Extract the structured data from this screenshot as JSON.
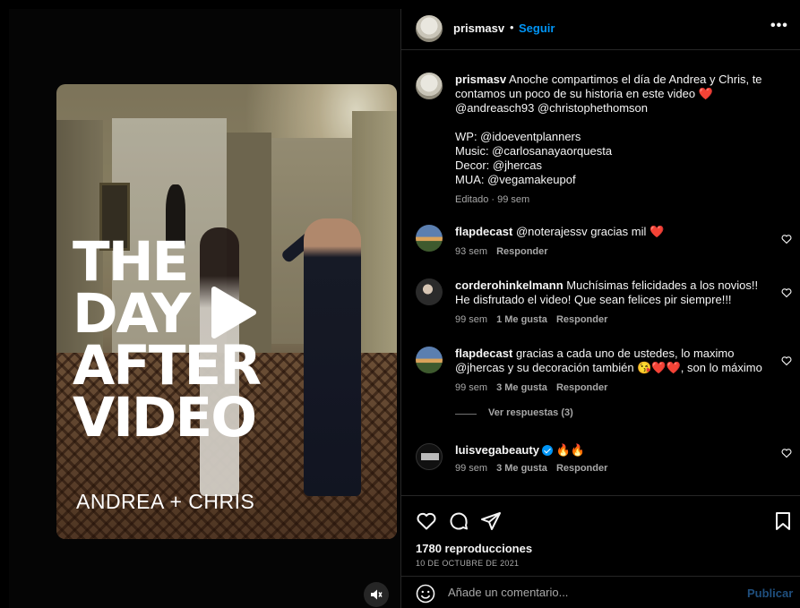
{
  "video": {
    "title_lines": [
      "THE",
      "DAY",
      "AFTER",
      "VIDEO"
    ],
    "subtitle": "ANDREA + CHRIS"
  },
  "header": {
    "username": "prismasv",
    "dot": "•",
    "follow_label": "Seguir",
    "more": "•••"
  },
  "caption": {
    "username": "prismasv",
    "lines": [
      "Anoche compartimos el día de Andrea y Chris, te",
      "contamos un poco de su historia en este video ❤️",
      "@andreasch93 @christophethomson",
      "",
      "WP: @idoeventplanners",
      "Music: @carlosanayaorquesta",
      "Decor: @jhercas",
      "MUA: @vegamakeupof"
    ],
    "meta": "Editado · 99 sem"
  },
  "comments": [
    {
      "username": "flapdecast",
      "text": "@noterajessv gracias mil ❤️",
      "time": "93 sem",
      "likes": "",
      "reply": "Responder"
    },
    {
      "username": "corderohinkelmann",
      "text": "Muchísimas felicidades a los novios!! He disfrutado el video! Que sean felices pir siempre!!!",
      "time": "99 sem",
      "likes": "1 Me gusta",
      "reply": "Responder"
    },
    {
      "username": "flapdecast",
      "text": "gracias a cada uno de ustedes, lo maximo @jhercas y su decoración también 😘❤️❤️, son lo máximo",
      "time": "99 sem",
      "likes": "3 Me gusta",
      "reply": "Responder"
    },
    {
      "username": "luisvegabeauty",
      "text": "🔥🔥",
      "time": "99 sem",
      "likes": "3 Me gusta",
      "reply": "Responder"
    }
  ],
  "view_replies": "Ver respuestas (3)",
  "stats": {
    "views": "1780 reproducciones",
    "date": "10 DE OCTUBRE DE 2021"
  },
  "add_comment": {
    "placeholder": "Añade un comentario...",
    "publish_label": "Publicar"
  },
  "colors": {
    "accent": "#0095f6",
    "text": "#f5f5f5",
    "muted": "#a8a8a8",
    "background": "#000000"
  },
  "icons": [
    "heart-icon",
    "comment-icon",
    "share-icon",
    "bookmark-icon",
    "emoji-icon",
    "mute-icon",
    "play-icon",
    "more-icon",
    "verified-icon"
  ]
}
